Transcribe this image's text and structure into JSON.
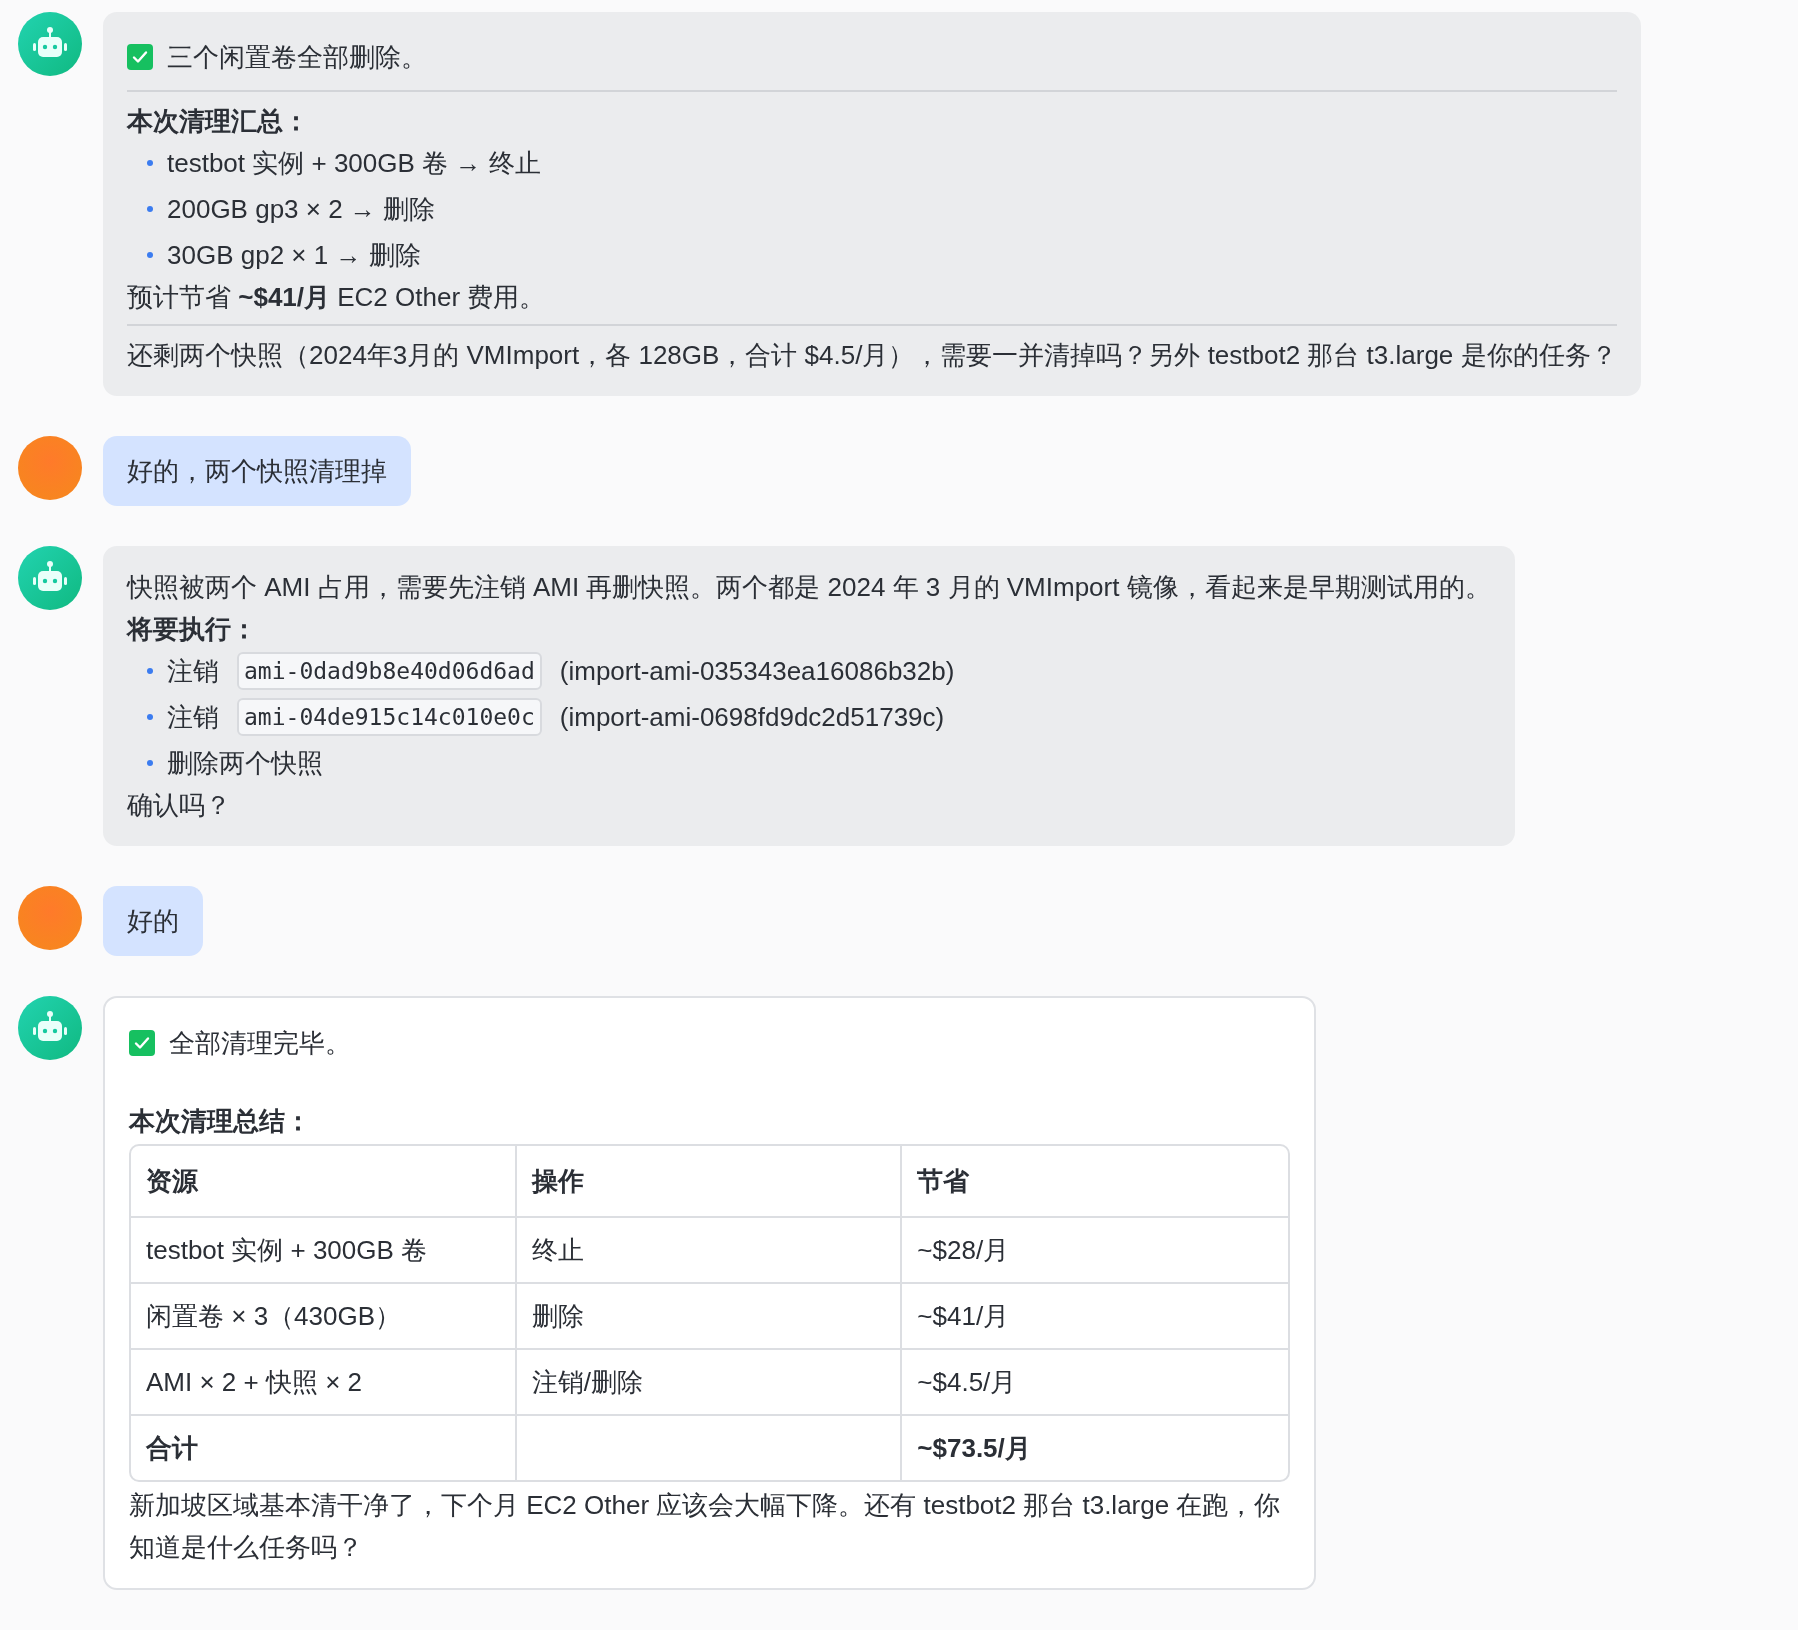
{
  "messages": [
    {
      "kind": "bot",
      "blocks": [
        {
          "kind": "check",
          "checked": true,
          "text": "三个闲置卷全部删除。"
        },
        {
          "kind": "divider"
        },
        {
          "kind": "heading",
          "text": "本次清理汇总："
        },
        {
          "kind": "bullets",
          "items": [
            {
              "text": "testbot 实例 + 300GB 卷 → 终止"
            },
            {
              "text": "200GB gp3 × 2 → 删除"
            },
            {
              "text": "30GB gp2 × 1 → 删除"
            }
          ]
        },
        {
          "kind": "paragraph",
          "text": "预计节省 **~$41/月** EC2 Other 费用。"
        },
        {
          "kind": "divider"
        },
        {
          "kind": "paragraph",
          "text": "还剩两个快照（2024年3月的 VMImport，各 128GB，合计 $4.5/月），需要一并清掉吗？另外 testbot2 那台 t3.large 是你的任务？"
        }
      ]
    },
    {
      "kind": "user",
      "blocks": [
        {
          "kind": "paragraph",
          "text": "好的，两个快照清理掉"
        }
      ]
    },
    {
      "kind": "bot",
      "blocks": [
        {
          "kind": "paragraph",
          "text": "快照被两个 AMI 占用，需要先注销 AMI 再删快照。两个都是 2024 年 3 月的 VMImport 镜像，看起来是早期测试用的。"
        },
        {
          "kind": "heading",
          "text": "将要执行："
        },
        {
          "kind": "bullets",
          "items": [
            {
              "text": "注销",
              "code": "ami-0dad9b8e40d06d6ad",
              "note": "(import-ami-035343ea16086b32b)"
            },
            {
              "text": "注销",
              "code": "ami-04de915c14c010e0c",
              "note": "(import-ami-0698fd9dc2d51739c)"
            },
            {
              "text": "删除两个快照"
            }
          ]
        },
        {
          "kind": "paragraph",
          "text": "确认吗？"
        }
      ]
    },
    {
      "kind": "user",
      "blocks": [
        {
          "kind": "paragraph",
          "text": "好的"
        }
      ]
    },
    {
      "kind": "bot_card",
      "blocks": [
        {
          "kind": "check",
          "checked": true,
          "text": "全部清理完毕。"
        },
        {
          "kind": "heading",
          "text": "本次清理总结："
        },
        {
          "kind": "table",
          "columns": [
            "资源",
            "操作",
            "节省"
          ],
          "rows": [
            {
              "bold": false,
              "cells": [
                "testbot 实例 + 300GB 卷",
                "终止",
                "~$28/月"
              ]
            },
            {
              "bold": false,
              "cells": [
                "闲置卷 × 3（430GB）",
                "删除",
                "~$41/月"
              ]
            },
            {
              "bold": false,
              "cells": [
                "AMI × 2 + 快照 × 2",
                "注销/删除",
                "~$4.5/月"
              ]
            },
            {
              "bold": true,
              "cells": [
                "合计",
                "",
                "~$73.5/月"
              ]
            }
          ]
        },
        {
          "kind": "paragraph",
          "text": "新加坡区域基本清干净了，下个月 EC2 Other 应该会大幅下降。还有 testbot2 那台 t3.large 在跑，你知道是什么任务吗？"
        }
      ]
    }
  ]
}
